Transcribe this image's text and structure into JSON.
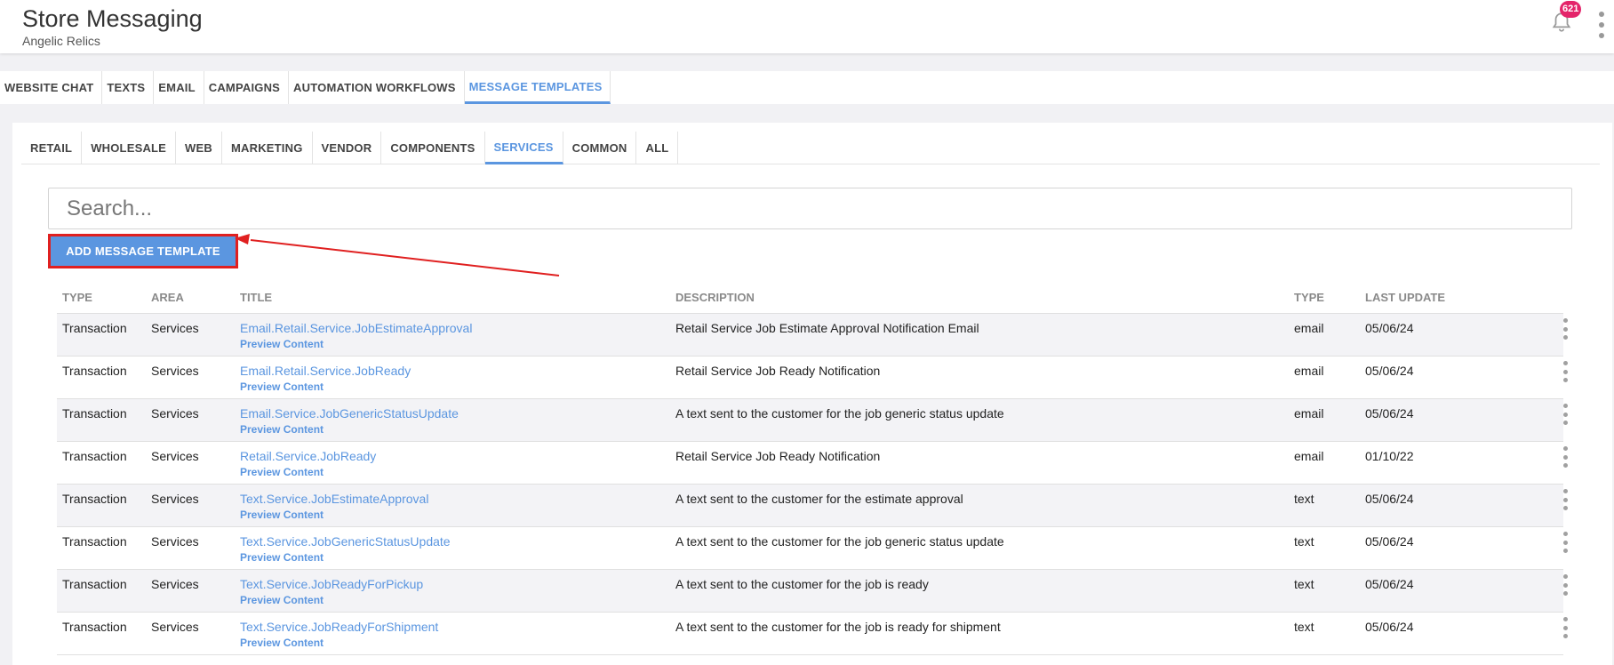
{
  "header": {
    "title": "Store Messaging",
    "subtitle": "Angelic Relics",
    "notifications_count": "621",
    "bell_icon": "bell-icon",
    "more_icon": "more-vertical-icon"
  },
  "top_tabs": [
    {
      "label": "WEBSITE CHAT",
      "active": false
    },
    {
      "label": "TEXTS",
      "active": false
    },
    {
      "label": "EMAIL",
      "active": false
    },
    {
      "label": "CAMPAIGNS",
      "active": false
    },
    {
      "label": "AUTOMATION WORKFLOWS",
      "active": false
    },
    {
      "label": "MESSAGE TEMPLATES",
      "active": true
    }
  ],
  "sub_tabs": [
    {
      "label": "RETAIL",
      "active": false
    },
    {
      "label": "WHOLESALE",
      "active": false
    },
    {
      "label": "WEB",
      "active": false
    },
    {
      "label": "MARKETING",
      "active": false
    },
    {
      "label": "VENDOR",
      "active": false
    },
    {
      "label": "COMPONENTS",
      "active": false
    },
    {
      "label": "SERVICES",
      "active": true
    },
    {
      "label": "COMMON",
      "active": false
    },
    {
      "label": "ALL",
      "active": false
    }
  ],
  "search": {
    "placeholder": "Search...",
    "value": ""
  },
  "add_button_label": "ADD MESSAGE TEMPLATE",
  "colors": {
    "accent": "#5b96e0",
    "highlight": "#e02020",
    "badge": "#e4246a"
  },
  "table": {
    "columns": [
      "TYPE",
      "AREA",
      "TITLE",
      "DESCRIPTION",
      "TYPE",
      "LAST UPDATE"
    ],
    "preview_label": "Preview Content",
    "rows": [
      {
        "type": "Transaction",
        "area": "Services",
        "title": "Email.Retail.Service.JobEstimateApproval",
        "description": "Retail Service Job Estimate Approval Notification Email",
        "ttype": "email",
        "last_update": "05/06/24"
      },
      {
        "type": "Transaction",
        "area": "Services",
        "title": "Email.Retail.Service.JobReady",
        "description": "Retail Service Job Ready Notification",
        "ttype": "email",
        "last_update": "05/06/24"
      },
      {
        "type": "Transaction",
        "area": "Services",
        "title": "Email.Service.JobGenericStatusUpdate",
        "description": "A text sent to the customer for the job generic status update",
        "ttype": "email",
        "last_update": "05/06/24"
      },
      {
        "type": "Transaction",
        "area": "Services",
        "title": "Retail.Service.JobReady",
        "description": "Retail Service Job Ready Notification",
        "ttype": "email",
        "last_update": "01/10/22"
      },
      {
        "type": "Transaction",
        "area": "Services",
        "title": "Text.Service.JobEstimateApproval",
        "description": "A text sent to the customer for the estimate approval",
        "ttype": "text",
        "last_update": "05/06/24"
      },
      {
        "type": "Transaction",
        "area": "Services",
        "title": "Text.Service.JobGenericStatusUpdate",
        "description": "A text sent to the customer for the job generic status update",
        "ttype": "text",
        "last_update": "05/06/24"
      },
      {
        "type": "Transaction",
        "area": "Services",
        "title": "Text.Service.JobReadyForPickup",
        "description": "A text sent to the customer for the job is ready",
        "ttype": "text",
        "last_update": "05/06/24"
      },
      {
        "type": "Transaction",
        "area": "Services",
        "title": "Text.Service.JobReadyForShipment",
        "description": "A text sent to the customer for the job is ready for shipment",
        "ttype": "text",
        "last_update": "05/06/24"
      }
    ]
  }
}
